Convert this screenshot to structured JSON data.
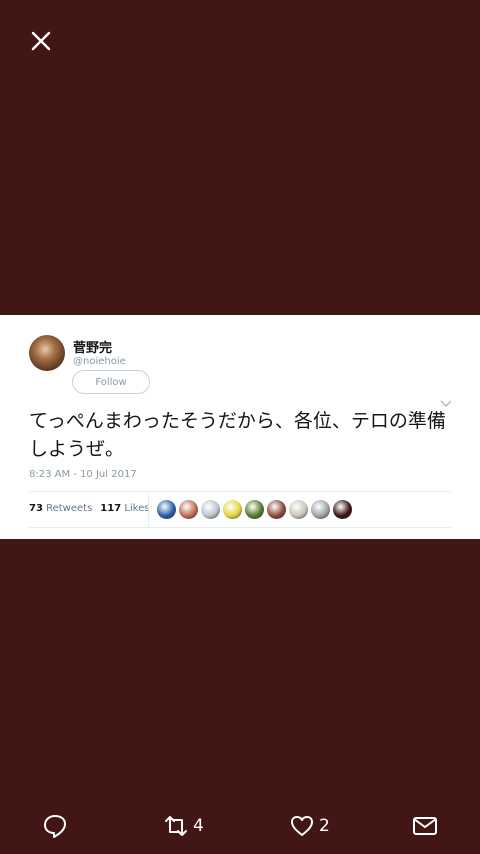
{
  "viewer": {
    "close_icon": "close-icon"
  },
  "tweet": {
    "display_name": "菅野完",
    "handle": "@noiehoie",
    "follow_label": "Follow",
    "text": "てっぺんまわったそうだから、各位、テロの準備しようぜ。",
    "timestamp": "8:23 AM - 10 Jul 2017",
    "retweets_count": "73",
    "retweets_label": "Retweets",
    "likes_count": "117",
    "likes_label": "Likes",
    "likers": [
      "#2a5ea8",
      "#c06a55",
      "#b9c4cc",
      "#e0d63a",
      "#5a7a2e",
      "#8a4b3c",
      "#c9c4b8",
      "#a0a4a8",
      "#3a1414"
    ]
  },
  "toolbar": {
    "reply_icon": "reply-icon",
    "retweet_icon": "retweet-icon",
    "retweet_count": "4",
    "like_icon": "heart-icon",
    "like_count": "2",
    "dm_icon": "mail-icon"
  }
}
